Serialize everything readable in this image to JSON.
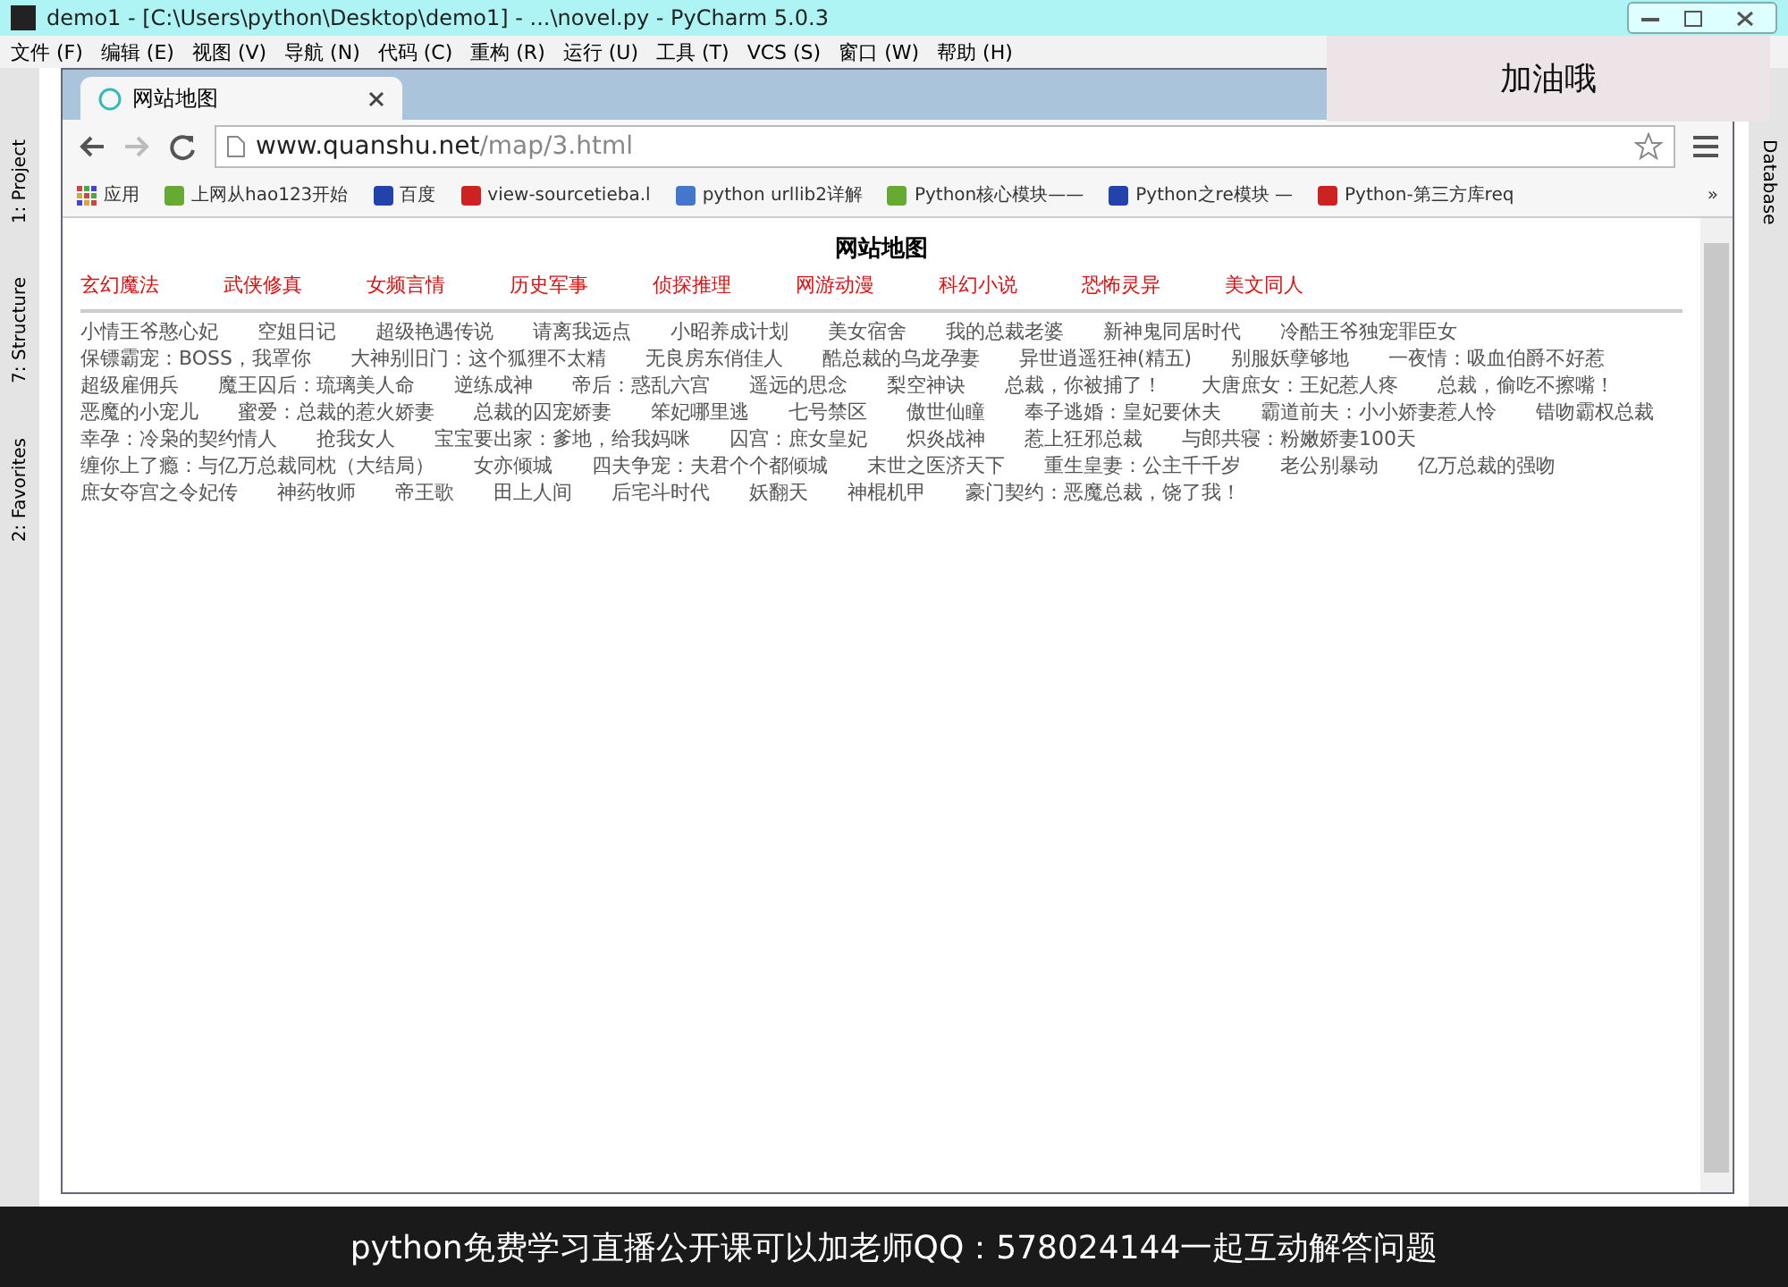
{
  "ide": {
    "title": "demo1 - [C:\\Users\\python\\Desktop\\demo1] - ...\\novel.py - PyCharm 5.0.3",
    "menu": [
      "文件 (F)",
      "编辑 (E)",
      "视图 (V)",
      "导航 (N)",
      "代码 (C)",
      "重构 (R)",
      "运行 (U)",
      "工具 (T)",
      "VCS (S)",
      "窗口 (W)",
      "帮助 (H)"
    ],
    "left_tools": [
      "1: Project",
      "7: Structure",
      "2: Favorites"
    ],
    "right_tools": [
      "Database"
    ]
  },
  "overlay_note": "加油哦",
  "browser": {
    "tab": {
      "title": "网站地图",
      "selected": true
    },
    "url_host": "www.quanshu.net",
    "url_path": "/map/3.html",
    "bookmarks": [
      {
        "label": "应用"
      },
      {
        "label": "上网从hao123开始"
      },
      {
        "label": "百度"
      },
      {
        "label": "view-sourcetieba.l"
      },
      {
        "label": "python urllib2详解"
      },
      {
        "label": "Python核心模块——"
      },
      {
        "label": "Python之re模块 —"
      },
      {
        "label": "Python-第三方库req"
      }
    ],
    "bookmarks_more": "»",
    "page": {
      "heading": "网站地图",
      "categories": [
        "玄幻魔法",
        "武侠修真",
        "女频言情",
        "历史军事",
        "侦探推理",
        "网游动漫",
        "科幻小说",
        "恐怖灵异",
        "美文同人"
      ],
      "titles": [
        "小情王爷憨心妃",
        "空姐日记",
        "超级艳遇传说",
        "请离我远点",
        "小昭养成计划",
        "美女宿舍",
        "我的总裁老婆",
        "新神鬼同居时代",
        "冷酷王爷独宠罪臣女",
        "保镖霸宠：BOSS，我罩你",
        "大神别旧门：这个狐狸不太精",
        "无良房东俏佳人",
        "酷总裁的乌龙孕妻",
        "异世逍遥狂神(精五)",
        "别服妖孽够地",
        "一夜情：吸血伯爵不好惹",
        "超级雇佣兵",
        "魔王囚后：琉璃美人命",
        "逆练成神",
        "帝后：惑乱六宫",
        "遥远的思念",
        "梨空神诀",
        "总裁，你被捕了！",
        "大唐庶女：王妃惹人疼",
        "总裁，偷吃不擦嘴！",
        "恶魔的小宠儿",
        "蜜爱：总裁的惹火娇妻",
        "总裁的囚宠娇妻",
        "笨妃哪里逃",
        "七号禁区",
        "傲世仙瞳",
        "奉子逃婚：皇妃要休夫",
        "霸道前夫：小小娇妻惹人怜",
        "错吻霸权总裁",
        "幸孕：冷枭的契约情人",
        "抢我女人",
        "宝宝要出家：爹地，给我妈咪",
        "囚宫：庶女皇妃",
        "炽炎战神",
        "惹上狂邪总裁",
        "与郎共寝：粉嫩娇妻100天",
        "缠你上了瘾：与亿万总裁同枕（大结局）",
        "女亦倾城",
        "四夫争宠：夫君个个都倾城",
        "末世之医济天下",
        "重生皇妻：公主千千岁",
        "老公别暴动",
        "亿万总裁的强吻",
        "庶女夺宫之令妃传",
        "神药牧师",
        "帝王歌",
        "田上人间",
        "后宅斗时代",
        "妖翻天",
        "神棍机甲",
        "豪门契约：恶魔总裁，饶了我！"
      ]
    }
  },
  "caption": "python免费学习直播公开课可以加老师QQ：578024144一起互动解答问题"
}
